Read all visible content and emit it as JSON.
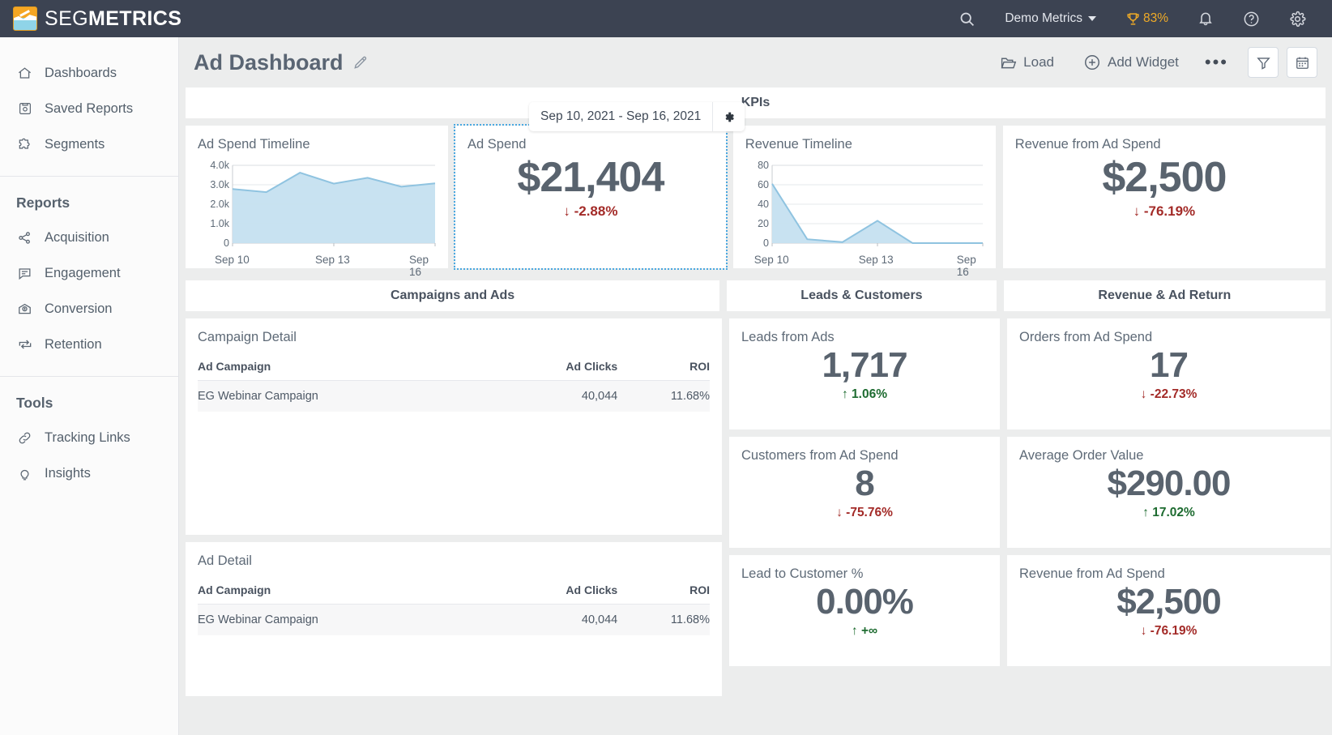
{
  "topbar": {
    "brand_light": "SEG",
    "brand_bold": "METRICS",
    "search_label": "search-icon",
    "account": "Demo Metrics",
    "trophy_pct": "83%",
    "icons": [
      "search-icon",
      "bell-icon",
      "help-icon",
      "gear-icon"
    ]
  },
  "sidebar": {
    "primary": [
      {
        "label": "Dashboards",
        "icon": "home-icon"
      },
      {
        "label": "Saved Reports",
        "icon": "save-icon"
      },
      {
        "label": "Segments",
        "icon": "puzzle-icon"
      }
    ],
    "reports_heading": "Reports",
    "reports": [
      {
        "label": "Acquisition",
        "icon": "share-nodes-icon"
      },
      {
        "label": "Engagement",
        "icon": "comment-icon"
      },
      {
        "label": "Conversion",
        "icon": "envelope-dollar-icon"
      },
      {
        "label": "Retention",
        "icon": "repeat-icon"
      }
    ],
    "tools_heading": "Tools",
    "tools": [
      {
        "label": "Tracking Links",
        "icon": "link-icon"
      },
      {
        "label": "Insights",
        "icon": "lightbulb-icon"
      }
    ]
  },
  "page": {
    "title": "Ad Dashboard",
    "edit_icon": "pencil-icon",
    "actions": {
      "load": "Load",
      "add_widget": "Add Widget",
      "more": "•••",
      "filter_icon": "filter-icon",
      "calendar_icon": "calendar-icon"
    },
    "date_range": "Sep 10, 2021 - Sep 16, 2021",
    "date_gear_icon": "gear-icon"
  },
  "bands": {
    "kpis": "KPIs",
    "campaigns_and_ads": "Campaigns and Ads",
    "leads_and_customers": "Leads & Customers",
    "revenue_and_ad_return": "Revenue & Ad Return"
  },
  "kpi_cards": {
    "ad_spend": {
      "title": "Ad Spend",
      "value": "$21,404",
      "delta": "-2.88%",
      "dir": "down",
      "arrow": "↓",
      "selected": true
    },
    "revenue_from_ad_spend": {
      "title": "Revenue from Ad Spend",
      "value": "$2,500",
      "delta": "-76.19%",
      "dir": "down",
      "arrow": "↓"
    }
  },
  "leads_customers": [
    {
      "title": "Leads from Ads",
      "value": "1,717",
      "delta": "1.06%",
      "dir": "up",
      "arrow": "↑"
    },
    {
      "title": "Customers from Ad Spend",
      "value": "8",
      "delta": "-75.76%",
      "dir": "down",
      "arrow": "↓"
    },
    {
      "title": "Lead to Customer %",
      "value": "0.00%",
      "delta": "+∞",
      "dir": "up",
      "arrow": "↑"
    }
  ],
  "revenue_ad_return": [
    {
      "title": "Orders from Ad Spend",
      "value": "17",
      "delta": "-22.73%",
      "dir": "down",
      "arrow": "↓"
    },
    {
      "title": "Average Order Value",
      "value": "$290.00",
      "delta": "17.02%",
      "dir": "up",
      "arrow": "↑"
    },
    {
      "title": "Revenue from Ad Spend",
      "value": "$2,500",
      "delta": "-76.19%",
      "dir": "down",
      "arrow": "↓"
    }
  ],
  "tables": [
    {
      "title": "Campaign Detail",
      "columns": [
        "Ad Campaign",
        "Ad Clicks",
        "ROI"
      ],
      "rows": [
        [
          "EG Webinar Campaign",
          "40,044",
          "11.68%"
        ]
      ]
    },
    {
      "title": "Ad Detail",
      "columns": [
        "Ad Campaign",
        "Ad Clicks",
        "ROI"
      ],
      "rows": [
        [
          "EG Webinar Campaign",
          "40,044",
          "11.68%"
        ]
      ]
    }
  ],
  "chart_data": [
    {
      "type": "area",
      "title": "Ad Spend Timeline",
      "x": [
        "Sep 10",
        "Sep 11",
        "Sep 12",
        "Sep 13",
        "Sep 14",
        "Sep 15",
        "Sep 16"
      ],
      "values": [
        2780,
        2620,
        3620,
        3060,
        3360,
        2900,
        3070
      ],
      "ytick_labels": [
        "4.0k",
        "3.0k",
        "2.0k",
        "1.0k",
        "0"
      ],
      "yticks": [
        4000,
        3000,
        2000,
        1000,
        0
      ],
      "xtick_labels": [
        "Sep 10",
        "Sep 13",
        "Sep 16"
      ],
      "ylim": [
        0,
        4000
      ],
      "grid": true,
      "color": "#9cc9e2",
      "fill": "#c5e0f0"
    },
    {
      "type": "area",
      "title": "Revenue Timeline",
      "x": [
        "Sep 10",
        "Sep 11",
        "Sep 12",
        "Sep 13",
        "Sep 14",
        "Sep 15",
        "Sep 16"
      ],
      "values": [
        61,
        4,
        1,
        23,
        0,
        0,
        0
      ],
      "ytick_labels": [
        "80",
        "60",
        "40",
        "20",
        "0"
      ],
      "yticks": [
        80,
        60,
        40,
        20,
        0
      ],
      "xtick_labels": [
        "Sep 10",
        "Sep 13",
        "Sep 16"
      ],
      "ylim": [
        0,
        80
      ],
      "grid": true,
      "color": "#9cc9e2",
      "fill": "#c5e0f0"
    }
  ],
  "colors": {
    "topbar_bg": "#3c4352",
    "accent_orange": "#f0ab27",
    "negative": "#a32b28",
    "positive": "#1d6b30",
    "chart_line": "#9cc9e2",
    "chart_fill": "#c5e0f0",
    "selection": "#4aa8e0"
  }
}
